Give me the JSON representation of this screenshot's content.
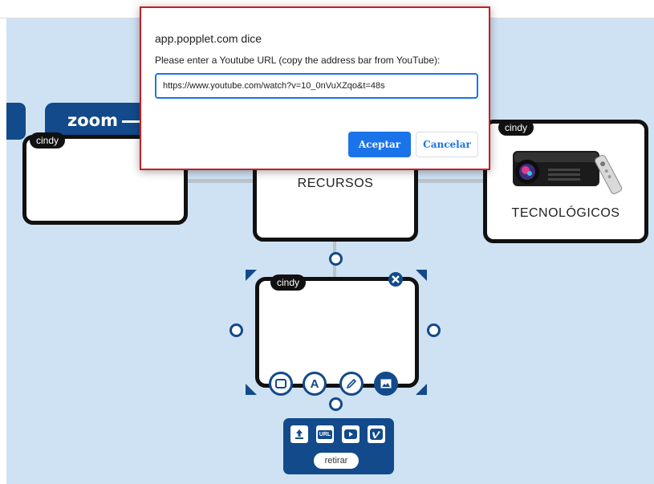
{
  "browser": {
    "frame": ""
  },
  "board": {
    "zoom_label": "zoom",
    "popples": [
      {
        "author": "cindy",
        "caption": ""
      },
      {
        "author": "",
        "caption": "RECURSOS"
      },
      {
        "author": "cindy",
        "caption": "TECNOLÓGICOS",
        "image": "projector-image"
      },
      {
        "author": "cindy",
        "caption": ""
      }
    ],
    "edit_tools": [
      {
        "name": "box-tool",
        "icon": "square-icon"
      },
      {
        "name": "text-tool",
        "icon": "letter-a-icon",
        "glyph": "A"
      },
      {
        "name": "draw-tool",
        "icon": "pencil-icon"
      },
      {
        "name": "image-tool",
        "icon": "image-icon"
      }
    ],
    "media_panel": {
      "buttons": [
        {
          "name": "upload",
          "icon": "upload-icon"
        },
        {
          "name": "url",
          "label": "URL"
        },
        {
          "name": "youtube",
          "icon": "youtube-icon"
        },
        {
          "name": "vimeo",
          "icon": "vimeo-icon"
        }
      ],
      "remove_label": "retirar"
    }
  },
  "dialog": {
    "title": "app.popplet.com dice",
    "message": "Please enter a Youtube URL (copy the address bar from YouTube):",
    "input_value": "https://www.youtube.com/watch?v=10_0nVuXZqo&t=48s",
    "ok_label": "Aceptar",
    "cancel_label": "Cancelar"
  },
  "colors": {
    "canvas": "#cfe2f3",
    "accent": "#124a8b",
    "dialog_border": "#c41e24",
    "button_blue": "#1a73e8"
  }
}
